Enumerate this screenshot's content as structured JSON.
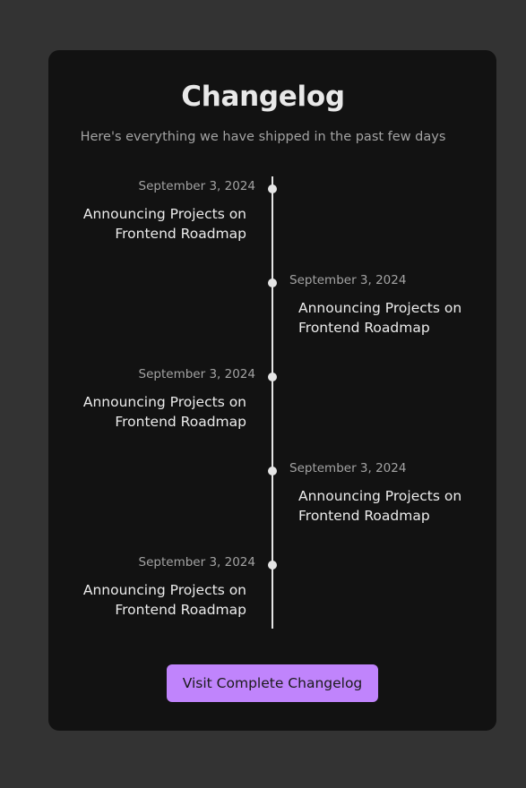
{
  "header": {
    "title": "Changelog",
    "subtitle": "Here's everything we have shipped in the past few days"
  },
  "entries": [
    {
      "date": "September 3, 2024",
      "title": "Announcing Projects on Frontend Roadmap",
      "side": "left"
    },
    {
      "date": "September 3, 2024",
      "title": "Announcing Projects on Frontend Roadmap",
      "side": "right"
    },
    {
      "date": "September 3, 2024",
      "title": "Announcing Projects on Frontend Roadmap",
      "side": "left"
    },
    {
      "date": "September 3, 2024",
      "title": "Announcing Projects on Frontend Roadmap",
      "side": "right"
    },
    {
      "date": "September 3, 2024",
      "title": "Announcing Projects on Frontend Roadmap",
      "side": "left"
    }
  ],
  "cta": {
    "label": "Visit Complete Changelog"
  },
  "colors": {
    "background": "#333333",
    "card": "#121212",
    "accent": "#c084fc",
    "timeline": "#e5e5e5"
  }
}
